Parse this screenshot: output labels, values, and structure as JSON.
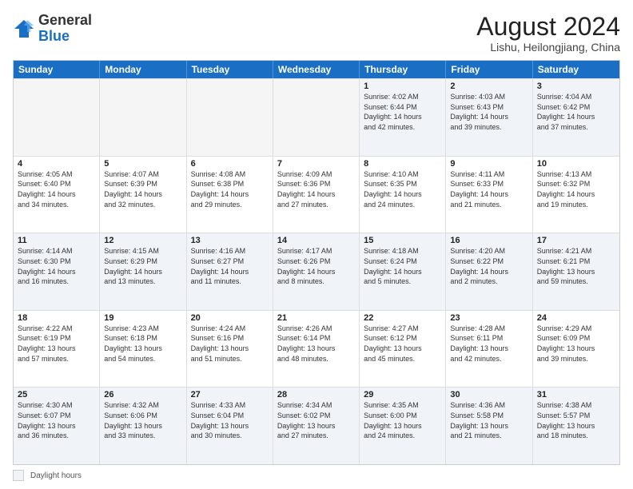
{
  "header": {
    "logo_general": "General",
    "logo_blue": "Blue",
    "month_year": "August 2024",
    "location": "Lishu, Heilongjiang, China"
  },
  "weekdays": [
    "Sunday",
    "Monday",
    "Tuesday",
    "Wednesday",
    "Thursday",
    "Friday",
    "Saturday"
  ],
  "legend": {
    "label": "Daylight hours"
  },
  "rows": [
    [
      {
        "day": "",
        "text": ""
      },
      {
        "day": "",
        "text": ""
      },
      {
        "day": "",
        "text": ""
      },
      {
        "day": "",
        "text": ""
      },
      {
        "day": "1",
        "text": "Sunrise: 4:02 AM\nSunset: 6:44 PM\nDaylight: 14 hours\nand 42 minutes."
      },
      {
        "day": "2",
        "text": "Sunrise: 4:03 AM\nSunset: 6:43 PM\nDaylight: 14 hours\nand 39 minutes."
      },
      {
        "day": "3",
        "text": "Sunrise: 4:04 AM\nSunset: 6:42 PM\nDaylight: 14 hours\nand 37 minutes."
      }
    ],
    [
      {
        "day": "4",
        "text": "Sunrise: 4:05 AM\nSunset: 6:40 PM\nDaylight: 14 hours\nand 34 minutes."
      },
      {
        "day": "5",
        "text": "Sunrise: 4:07 AM\nSunset: 6:39 PM\nDaylight: 14 hours\nand 32 minutes."
      },
      {
        "day": "6",
        "text": "Sunrise: 4:08 AM\nSunset: 6:38 PM\nDaylight: 14 hours\nand 29 minutes."
      },
      {
        "day": "7",
        "text": "Sunrise: 4:09 AM\nSunset: 6:36 PM\nDaylight: 14 hours\nand 27 minutes."
      },
      {
        "day": "8",
        "text": "Sunrise: 4:10 AM\nSunset: 6:35 PM\nDaylight: 14 hours\nand 24 minutes."
      },
      {
        "day": "9",
        "text": "Sunrise: 4:11 AM\nSunset: 6:33 PM\nDaylight: 14 hours\nand 21 minutes."
      },
      {
        "day": "10",
        "text": "Sunrise: 4:13 AM\nSunset: 6:32 PM\nDaylight: 14 hours\nand 19 minutes."
      }
    ],
    [
      {
        "day": "11",
        "text": "Sunrise: 4:14 AM\nSunset: 6:30 PM\nDaylight: 14 hours\nand 16 minutes."
      },
      {
        "day": "12",
        "text": "Sunrise: 4:15 AM\nSunset: 6:29 PM\nDaylight: 14 hours\nand 13 minutes."
      },
      {
        "day": "13",
        "text": "Sunrise: 4:16 AM\nSunset: 6:27 PM\nDaylight: 14 hours\nand 11 minutes."
      },
      {
        "day": "14",
        "text": "Sunrise: 4:17 AM\nSunset: 6:26 PM\nDaylight: 14 hours\nand 8 minutes."
      },
      {
        "day": "15",
        "text": "Sunrise: 4:18 AM\nSunset: 6:24 PM\nDaylight: 14 hours\nand 5 minutes."
      },
      {
        "day": "16",
        "text": "Sunrise: 4:20 AM\nSunset: 6:22 PM\nDaylight: 14 hours\nand 2 minutes."
      },
      {
        "day": "17",
        "text": "Sunrise: 4:21 AM\nSunset: 6:21 PM\nDaylight: 13 hours\nand 59 minutes."
      }
    ],
    [
      {
        "day": "18",
        "text": "Sunrise: 4:22 AM\nSunset: 6:19 PM\nDaylight: 13 hours\nand 57 minutes."
      },
      {
        "day": "19",
        "text": "Sunrise: 4:23 AM\nSunset: 6:18 PM\nDaylight: 13 hours\nand 54 minutes."
      },
      {
        "day": "20",
        "text": "Sunrise: 4:24 AM\nSunset: 6:16 PM\nDaylight: 13 hours\nand 51 minutes."
      },
      {
        "day": "21",
        "text": "Sunrise: 4:26 AM\nSunset: 6:14 PM\nDaylight: 13 hours\nand 48 minutes."
      },
      {
        "day": "22",
        "text": "Sunrise: 4:27 AM\nSunset: 6:12 PM\nDaylight: 13 hours\nand 45 minutes."
      },
      {
        "day": "23",
        "text": "Sunrise: 4:28 AM\nSunset: 6:11 PM\nDaylight: 13 hours\nand 42 minutes."
      },
      {
        "day": "24",
        "text": "Sunrise: 4:29 AM\nSunset: 6:09 PM\nDaylight: 13 hours\nand 39 minutes."
      }
    ],
    [
      {
        "day": "25",
        "text": "Sunrise: 4:30 AM\nSunset: 6:07 PM\nDaylight: 13 hours\nand 36 minutes."
      },
      {
        "day": "26",
        "text": "Sunrise: 4:32 AM\nSunset: 6:06 PM\nDaylight: 13 hours\nand 33 minutes."
      },
      {
        "day": "27",
        "text": "Sunrise: 4:33 AM\nSunset: 6:04 PM\nDaylight: 13 hours\nand 30 minutes."
      },
      {
        "day": "28",
        "text": "Sunrise: 4:34 AM\nSunset: 6:02 PM\nDaylight: 13 hours\nand 27 minutes."
      },
      {
        "day": "29",
        "text": "Sunrise: 4:35 AM\nSunset: 6:00 PM\nDaylight: 13 hours\nand 24 minutes."
      },
      {
        "day": "30",
        "text": "Sunrise: 4:36 AM\nSunset: 5:58 PM\nDaylight: 13 hours\nand 21 minutes."
      },
      {
        "day": "31",
        "text": "Sunrise: 4:38 AM\nSunset: 5:57 PM\nDaylight: 13 hours\nand 18 minutes."
      }
    ]
  ]
}
